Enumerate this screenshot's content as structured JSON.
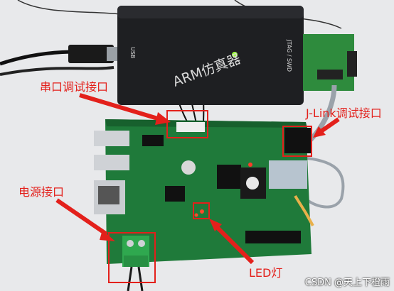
{
  "annotations": {
    "serial_debug_port": "串口调试接口",
    "jlink_debug_port": "J-Link调试接口",
    "power_port": "电源接口",
    "led_light": "LED灯"
  },
  "device_text": {
    "emulator_brand": "ARM仿真器",
    "usb_mark": "USB",
    "jtag_swd_mark": "JTAG / SWD"
  },
  "watermark": "CSDN @天上下橙雨",
  "colors": {
    "annotation_red": "#e3201b",
    "pcb_green": "#1f7a3a",
    "emulator_black": "#1e1f22",
    "terminal_green": "#2fa84f"
  }
}
